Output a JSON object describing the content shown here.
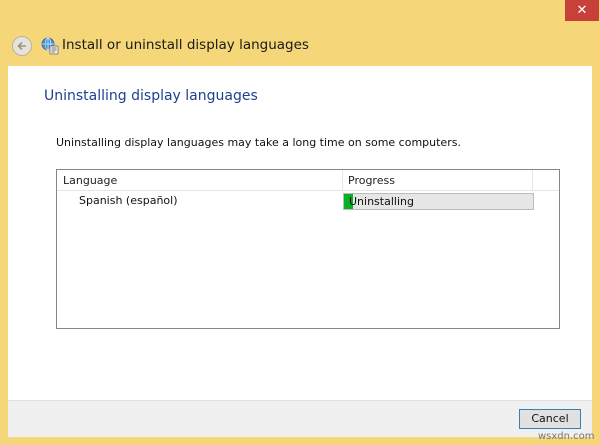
{
  "window": {
    "title": "Install or uninstall display languages",
    "close_glyph": "✕",
    "frame_color": "#f5d679",
    "close_color": "#c7413a"
  },
  "nav": {
    "back_icon": "back-arrow-icon",
    "app_icon": "globe-language-icon"
  },
  "main": {
    "heading": "Uninstalling display languages",
    "description": "Uninstalling display languages may take a long time on some computers.",
    "list": {
      "columns": [
        "Language",
        "Progress"
      ],
      "rows": [
        {
          "language": "Spanish (español)",
          "status": "Uninstalling",
          "progress": 0.05
        }
      ]
    }
  },
  "footer": {
    "cancel_label": "Cancel"
  },
  "watermark": "wsxdn.com",
  "colors": {
    "heading": "#1f3f8f",
    "progress_fill": "#06b025"
  }
}
